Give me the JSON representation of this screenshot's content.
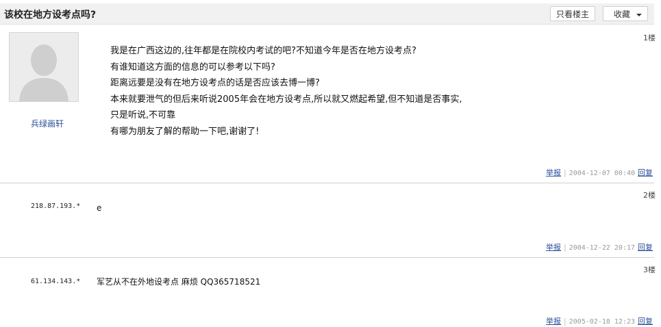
{
  "header": {
    "title": "该校在地方设考点吗?",
    "louzhu_label": "只看楼主",
    "favorite_label": "收藏"
  },
  "posts": [
    {
      "floor": "1楼",
      "username": "兵绿画轩",
      "lines": [
        "我是在广西这边的,往年都是在院校内考试的吧?不知道今年是否在地方设考点?",
        "有谁知道这方面的信息的可以参考以下吗?",
        "距离远要是没有在地方设考点的话是否应该去博一博?",
        "本来就要泄气的但后来听说2005年会在地方设考点,所以就又燃起希望,但不知道是否事实,",
        "只是听说,不可靠",
        "有哪为朋友了解的帮助一下吧,谢谢了!"
      ],
      "report_label": "举报",
      "date": "2004-12-07 00:40",
      "reply_label": "回复"
    },
    {
      "floor": "2楼",
      "ip": "218.87.193.*",
      "text": "e",
      "report_label": "举报",
      "date": "2004-12-22 20:17",
      "reply_label": "回复"
    },
    {
      "floor": "3楼",
      "ip": "61.134.143.*",
      "text": "军艺从不在外地设考点 麻烦 QQ365718521",
      "report_label": "举报",
      "date": "2005-02-18 12:23",
      "reply_label": "回复"
    }
  ],
  "separator": "|"
}
